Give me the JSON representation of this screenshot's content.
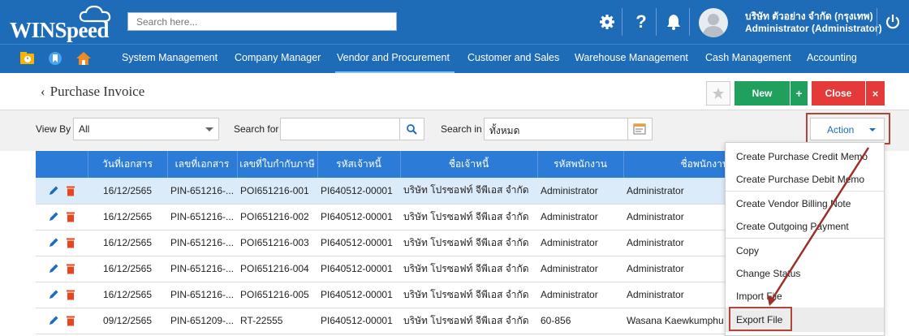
{
  "app": {
    "logo_text": "WINSpeed"
  },
  "search": {
    "placeholder": "Search here..."
  },
  "user": {
    "company": "บริษัท ตัวอย่าง จำกัด (กรุงเทพ)",
    "role": "Administrator (Administrator)"
  },
  "menu": {
    "items": [
      {
        "label": "System Management"
      },
      {
        "label": "Company Manager"
      },
      {
        "label": "Vendor and Procurement",
        "active": true
      },
      {
        "label": "Customer and Sales"
      },
      {
        "label": "Warehouse Management"
      },
      {
        "label": "Cash Management"
      },
      {
        "label": "Accounting"
      }
    ]
  },
  "page": {
    "title": "Purchase Invoice",
    "back_icon": "chevron-left-icon"
  },
  "toolbar": {
    "new_label": "New",
    "new_plus": "+",
    "close_label": "Close",
    "close_x": "×"
  },
  "filter": {
    "view_by_label": "View By",
    "view_by_value": "All",
    "search_for_label": "Search for",
    "search_for_value": "",
    "search_in_label": "Search in",
    "search_in_value": "ทั้งหมด",
    "action_label": "Action"
  },
  "table": {
    "columns": [
      "",
      "วันที่เอกสาร",
      "เลขที่เอกสาร",
      "เลขที่ใบกำกับภาษี",
      "รหัสเจ้าหนี้",
      "ชื่อเจ้าหนี้",
      "รหัสพนักงาน",
      "ชื่อพนักงาน"
    ],
    "rows": [
      {
        "date": "16/12/2565",
        "doc_no": "PIN-651216-...",
        "tax_no": "POI651216-001",
        "vendor_code": "PI640512-00001",
        "vendor_name": "บริษัท โปรซอฟท์ จีพีเอส จำกัด",
        "emp_code": "Administrator",
        "emp_name": "Administrator",
        "selected": true
      },
      {
        "date": "16/12/2565",
        "doc_no": "PIN-651216-...",
        "tax_no": "POI651216-002",
        "vendor_code": "PI640512-00001",
        "vendor_name": "บริษัท โปรซอฟท์ จีพีเอส จำกัด",
        "emp_code": "Administrator",
        "emp_name": "Administrator"
      },
      {
        "date": "16/12/2565",
        "doc_no": "PIN-651216-...",
        "tax_no": "POI651216-003",
        "vendor_code": "PI640512-00001",
        "vendor_name": "บริษัท โปรซอฟท์ จีพีเอส จำกัด",
        "emp_code": "Administrator",
        "emp_name": "Administrator"
      },
      {
        "date": "16/12/2565",
        "doc_no": "PIN-651216-...",
        "tax_no": "POI651216-004",
        "vendor_code": "PI640512-00001",
        "vendor_name": "บริษัท โปรซอฟท์ จีพีเอส จำกัด",
        "emp_code": "Administrator",
        "emp_name": "Administrator"
      },
      {
        "date": "16/12/2565",
        "doc_no": "PIN-651216-...",
        "tax_no": "POI651216-005",
        "vendor_code": "PI640512-00001",
        "vendor_name": "บริษัท โปรซอฟท์ จีพีเอส จำกัด",
        "emp_code": "Administrator",
        "emp_name": "Administrator"
      },
      {
        "date": "09/12/2565",
        "doc_no": "PIN-651209-...",
        "tax_no": "RT-22555",
        "vendor_code": "PI640512-00001",
        "vendor_name": "บริษัท โปรซอฟท์ จีพีเอส จำกัด",
        "emp_code": "60-856",
        "emp_name": "Wasana Kaewkumphu"
      }
    ]
  },
  "action_menu": {
    "items": [
      "Create Purchase Credit Memo",
      "Create Purchase Debit Memo",
      "Create Vendor Billing Note",
      "Create Outgoing Payment",
      "Copy",
      "Change Status",
      "Import File",
      "Export File"
    ]
  },
  "colors": {
    "brand": "#1e6cb8",
    "header": "#2c7bd6",
    "new": "#1fa05c",
    "close": "#e43a3a",
    "highlight": "#b0463a"
  }
}
